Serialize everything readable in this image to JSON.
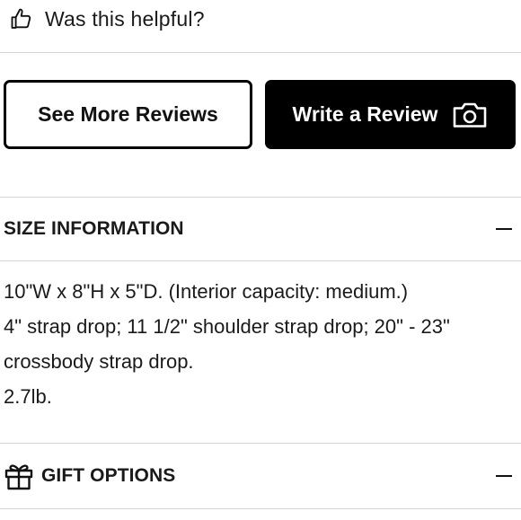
{
  "feedback": {
    "helpful_label": "Was this helpful?",
    "icon": "thumbs-up-icon"
  },
  "actions": {
    "see_more_label": "See More Reviews",
    "write_review_label": "Write a Review",
    "write_review_icon": "camera-icon"
  },
  "size_information": {
    "title": "SIZE INFORMATION",
    "state": "expanded",
    "toggle_icon": "minus-icon",
    "lines": [
      "10\"W x 8\"H x 5\"D. (Interior capacity: medium.)",
      "4\" strap drop; 11 1/2\" shoulder strap drop; 20\" - 23\"",
      "crossbody strap drop.",
      "2.7lb."
    ]
  },
  "gift_options": {
    "title": "GIFT OPTIONS",
    "icon": "gift-icon",
    "toggle_icon": "minus-icon"
  },
  "colors": {
    "text": "#111111",
    "divider": "#d6d6d6",
    "button_dark": "#000000",
    "button_light": "#ffffff"
  }
}
